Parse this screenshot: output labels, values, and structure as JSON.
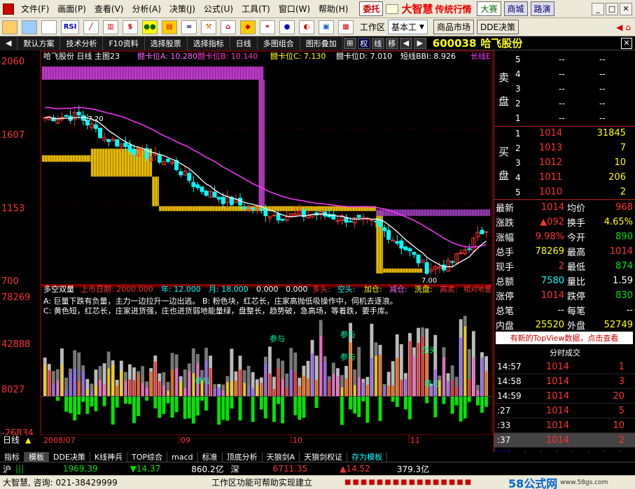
{
  "menubar": {
    "items": [
      "文件(F)",
      "画面(P)",
      "查看(V)",
      "分析(A)",
      "决策(J)",
      "公式(U)",
      "工具(T)",
      "窗口(W)",
      "帮助(H)"
    ],
    "weituo": "委托",
    "brand": "大智慧",
    "brand_sub": "传统行情",
    "dasai": "大赛",
    "shangcheng": "商城",
    "luyan": "路演"
  },
  "toolbar": {
    "icons": [
      "folder-icon",
      "chart-icon",
      "grid-icon",
      "rsi-icon",
      "line-icon",
      "bars-icon",
      "dollar-icon",
      "lights-icon",
      "stack-icon",
      "binoculars-icon",
      "tools-icon",
      "house-icon",
      "diamond-icon",
      "link-icon",
      "ball-icon",
      "sphere-icon",
      "window-icon",
      "page-icon"
    ],
    "rsi_label": "RSI",
    "workspace_label": "工作区",
    "workspace_value": "基本工",
    "market_button": "商品市场",
    "dde_button": "DDE决策"
  },
  "quickbar": {
    "items": [
      "默认方案",
      "技术分析",
      "F10资料",
      "选择股票",
      "选择指标",
      "日线",
      "多图组合",
      "图形叠加"
    ],
    "minis": [
      "权",
      "线",
      "移"
    ],
    "stock_code": "600038",
    "stock_name": "哈飞股份"
  },
  "main_chart": {
    "header": [
      "哈飞股份 日线 主图23",
      "闘卡位A: 10.280",
      "闘卡位B: 10.140",
      "闘卡位C: 7.130",
      "闘卡位D: 7.010",
      "短线BBI: 8.926",
      "长线E"
    ],
    "y_ticks": [
      "2060",
      "1607",
      "1153",
      "700"
    ],
    "peak_label": "17.20",
    "low_label": "7.00"
  },
  "sub_chart": {
    "header": [
      "多空双量",
      "上市日期: 2000.000",
      "年: 12.000",
      "月: 18.000",
      "0.000",
      "0.000",
      "多头:",
      "空头:",
      "加仓:",
      "减仓:",
      "洗盘:",
      "高卖:",
      "相对地量"
    ],
    "legend": [
      "A: 巨量下跌有负量，主力一边拉升一边出逃。    B: 粉色块，红芯长，庄家高抛低吸操作中，伺机去逐浪。",
      "C: 黄色短，红芯长，庄家进货强，庄也进货弱地能量绿，盘整长，趋势破，急高场，等着跌，要手库。"
    ],
    "y_ticks": [
      "78269",
      "42888",
      "8027",
      "-26834"
    ],
    "annotations": [
      "参与",
      "参与",
      "参与",
      "参与",
      "空头",
      "参与"
    ]
  },
  "time_axis": {
    "label": "日线",
    "months": [
      "2008/07",
      "09",
      "10",
      "11"
    ]
  },
  "orderbook": {
    "sell_label": "卖盘",
    "buy_label": "买盘",
    "sells": [
      {
        "level": "5",
        "price": "--",
        "vol": "--"
      },
      {
        "level": "4",
        "price": "--",
        "vol": "--"
      },
      {
        "level": "3",
        "price": "--",
        "vol": "--"
      },
      {
        "level": "2",
        "price": "--",
        "vol": "--"
      },
      {
        "level": "1",
        "price": "--",
        "vol": "--"
      }
    ],
    "buys": [
      {
        "level": "1",
        "price": "1014",
        "vol": "31845"
      },
      {
        "level": "2",
        "price": "1013",
        "vol": "7"
      },
      {
        "level": "3",
        "price": "1012",
        "vol": "10"
      },
      {
        "level": "4",
        "price": "1011",
        "vol": "206"
      },
      {
        "level": "5",
        "price": "1010",
        "vol": "2"
      }
    ]
  },
  "stats": [
    {
      "l1": "最新",
      "v1": "1014",
      "l2": "均价",
      "v2": "968"
    },
    {
      "l1": "涨跌",
      "v1": "▲092",
      "l2": "换手",
      "v2": "4.65%"
    },
    {
      "l1": "涨幅",
      "v1": "9.98%",
      "l2": "今开",
      "v2": "890"
    },
    {
      "l1": "总手",
      "v1": "78269",
      "l2": "最高",
      "v2": "1014"
    },
    {
      "l1": "现手",
      "v1": "2",
      "l2": "最低",
      "v2": "874"
    },
    {
      "l1": "总额",
      "v1": "7580",
      "l2": "量比",
      "v2": "1.59"
    },
    {
      "l1": "涨停",
      "v1": "1014",
      "l2": "跌停",
      "v2": "830"
    },
    {
      "l1": "总笔",
      "v1": "--",
      "l2": "每笔",
      "v2": "--"
    },
    {
      "l1": "内盘",
      "v1": "25520",
      "l2": "外盘",
      "v2": "52749"
    }
  ],
  "notice": "有新的TopView数据，点击查看",
  "ticks": {
    "header": "分时成交",
    "rows": [
      {
        "time": "14:57",
        "price": "1014",
        "vol": "1"
      },
      {
        "time": "14:58",
        "price": "1014",
        "vol": "3"
      },
      {
        "time": "14:59",
        "price": "1014",
        "vol": "20"
      },
      {
        "time": ":27",
        "price": "1014",
        "vol": "5"
      },
      {
        "time": ":33",
        "price": "1014",
        "vol": "10"
      },
      {
        "time": ":37",
        "price": "1014",
        "vol": "2"
      }
    ],
    "tabs": [
      "细",
      "逐",
      "则",
      "价",
      "指",
      "势",
      "识",
      "钱",
      "评"
    ]
  },
  "bottom_tabs": [
    "指标",
    "模板",
    "DDE决策",
    "K线神兵",
    "TOP综合",
    "macd",
    "标准",
    "顶底分析",
    "天狼剑A",
    "天狼剑权证",
    "存为模板"
  ],
  "index_bar": {
    "sh_label": "沪",
    "sh_value": "1969.39",
    "sh_change": "▼14.37",
    "sh_amount": "860.2亿",
    "shen_label": "深",
    "sz_value": "6711.35",
    "sz_change": "▲14.52",
    "sz_amount": "379.3亿"
  },
  "statusbar": {
    "left": "大智慧, 咨询: 021-38429999",
    "middle": "工作区功能可帮助实现建立",
    "logo": "58公式网",
    "logo_url": "www.58gs.com"
  },
  "chart_data": {
    "type": "candlestick",
    "price_range": [
      700,
      2060
    ],
    "volume_range": [
      -26834,
      78269
    ]
  }
}
